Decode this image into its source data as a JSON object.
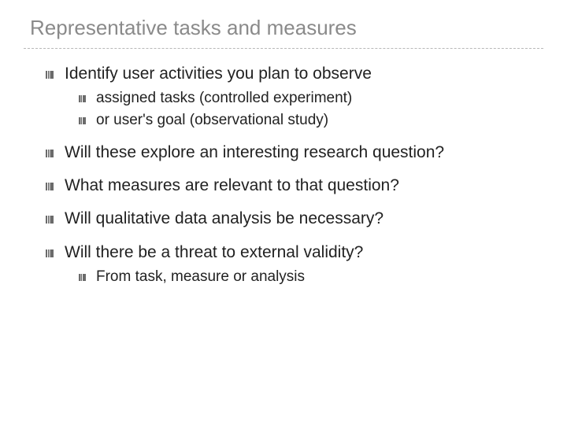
{
  "title": "Representative tasks and measures",
  "bullets": {
    "b0": "Identify user activities you plan to observe",
    "b0_sub": {
      "s0": "assigned tasks (controlled experiment)",
      "s1": "or user's goal (observational study)"
    },
    "b1": "Will these explore an interesting research question?",
    "b2": "What measures are relevant to that question?",
    "b3": "Will qualitative data analysis be necessary?",
    "b4": "Will there be a threat to external validity?",
    "b4_sub": {
      "s0": "From task, measure or analysis"
    }
  }
}
